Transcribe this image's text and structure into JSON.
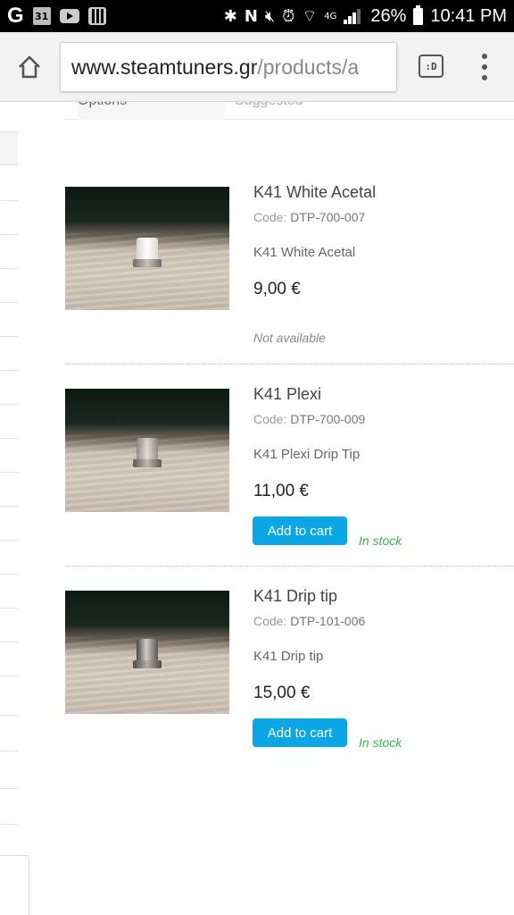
{
  "status_bar": {
    "battery": "26%",
    "time": "10:41 PM",
    "network": "4G",
    "calendar_day": "31",
    "icons": [
      "google-icon",
      "calendar-icon",
      "youtube-icon",
      "calendar-grid-icon",
      "bluetooth-icon",
      "nfc-icon",
      "mute-icon",
      "alarm-icon",
      "wifi-icon",
      "signal-icon",
      "battery-icon"
    ]
  },
  "browser": {
    "url_domain": "www.steamtuners.gr",
    "url_path": "/products/a",
    "tabs_label": ":D",
    "icons": [
      "home-icon",
      "tabs-icon",
      "menu-icon"
    ]
  },
  "options": {
    "label": "Options",
    "value": "Suggested"
  },
  "products": [
    {
      "title": "K41 White Acetal",
      "code_label": "Code:",
      "code": "DTP-700-007",
      "description": "K41 White Acetal",
      "price": "9,00 €",
      "availability": "Not available",
      "in_stock": false,
      "tip_color": "#f2f0ea"
    },
    {
      "title": "K41 Plexi",
      "code_label": "Code:",
      "code": "DTP-700-009",
      "description": "K41 Plexi Drip Tip",
      "price": "11,00 €",
      "button": "Add to cart",
      "availability": "In stock",
      "in_stock": true,
      "tip_color": "#c9c6c0"
    },
    {
      "title": "K41 Drip tip",
      "code_label": "Code:",
      "code": "DTP-101-006",
      "description": "K41 Drip tip",
      "price": "15,00 €",
      "button": "Add to cart",
      "availability": "In stock",
      "in_stock": true,
      "tip_color": "#8e8b86"
    }
  ],
  "colors": {
    "cart_button": "#0aa7e6",
    "in_stock": "#3bb54a",
    "status_bar": "#000000",
    "url_bar": "#f2f2f2"
  }
}
